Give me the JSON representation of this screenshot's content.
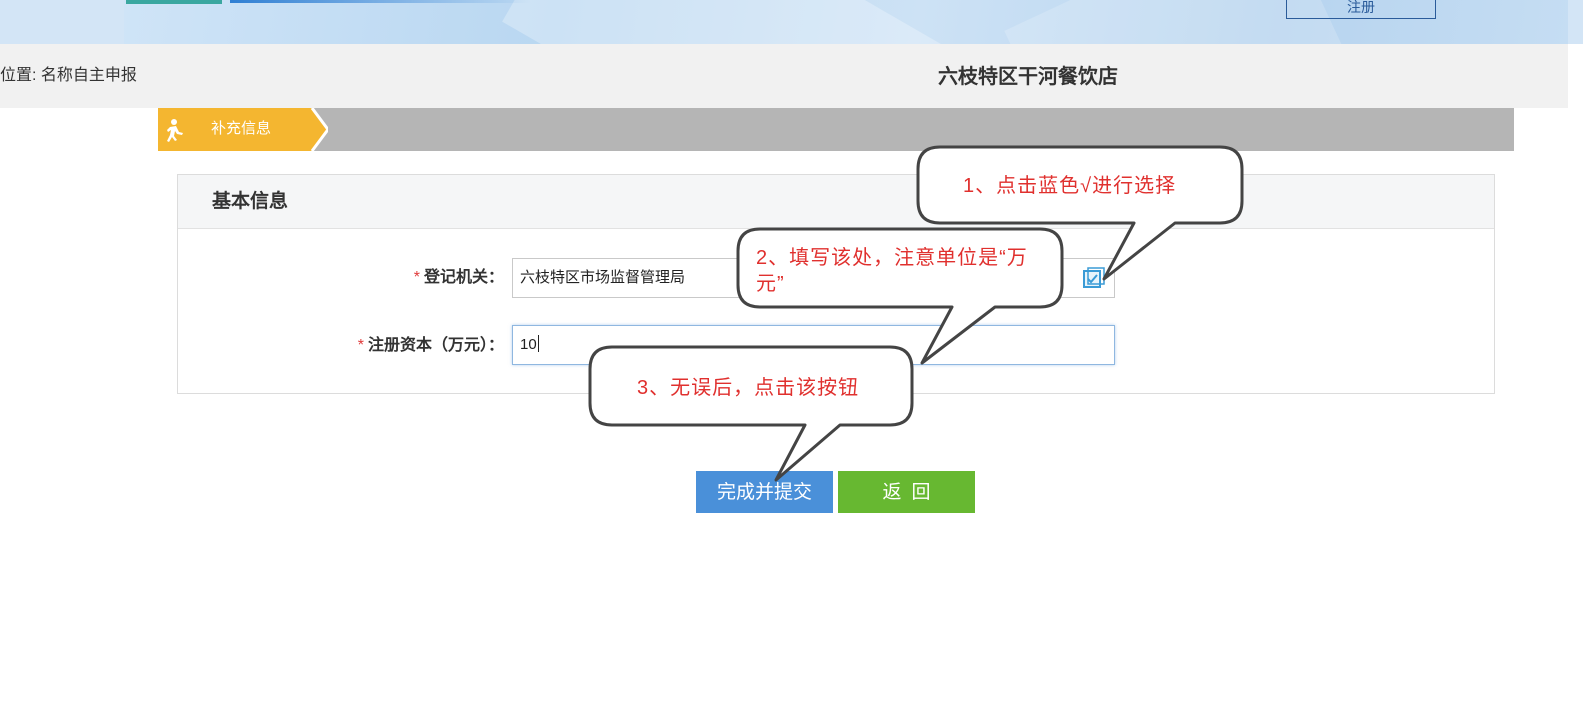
{
  "header": {
    "register_label": "注册"
  },
  "location": {
    "text": "位置: 名称自主申报",
    "store_name": "六枝特区干河餐饮店"
  },
  "steps": {
    "active_label": "补充信息"
  },
  "panel": {
    "title": "基本信息",
    "fields": [
      {
        "required_mark": "*",
        "label": "登记机关：",
        "value": "六枝特区市场监督管理局"
      },
      {
        "required_mark": "*",
        "label": "注册资本（万元）：",
        "value": "10"
      }
    ]
  },
  "buttons": {
    "submit_label": "完成并提交",
    "back_label": "返回"
  },
  "callouts": [
    {
      "text": "1、点击蓝色√进行选择"
    },
    {
      "text": "2、填写该处，注意单位是“万元”"
    },
    {
      "text": "3、无误后，点击该按钮"
    }
  ],
  "colors": {
    "accent_blue": "#4a90d9",
    "back_green": "#67b831",
    "step_orange": "#f4b630",
    "callout_red": "#e0302e",
    "required_red": "#e03a3a"
  },
  "icons": {
    "step_icon": "running-person-icon",
    "select_icon": "checkbox-select-icon"
  }
}
